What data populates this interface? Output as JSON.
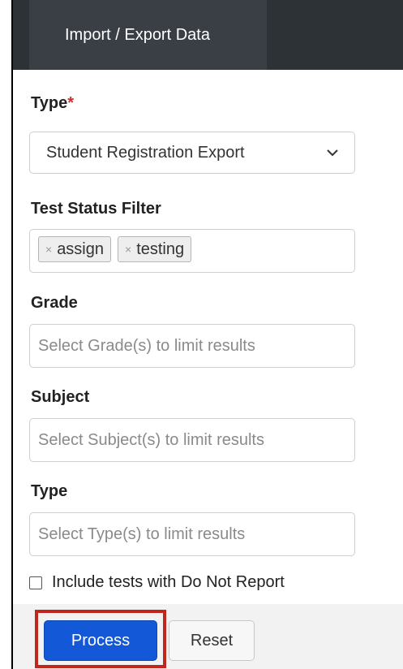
{
  "header": {
    "tab_title": "Import / Export Data"
  },
  "form": {
    "type_label": "Type",
    "required_marker": "*",
    "type_value": "Student Registration Export",
    "test_status_label": "Test Status Filter",
    "test_status_tags": [
      "assign",
      "testing"
    ],
    "tag_remove_glyph": "×",
    "grade_label": "Grade",
    "grade_placeholder": "Select Grade(s) to limit results",
    "subject_label": "Subject",
    "subject_placeholder": "Select Subject(s) to limit results",
    "type2_label": "Type",
    "type2_placeholder": "Select Type(s) to limit results",
    "do_not_report_label": "Include tests with Do Not Report",
    "do_not_report_checked": false
  },
  "actions": {
    "process_label": "Process",
    "reset_label": "Reset",
    "highlight_color": "#c0261b",
    "process_color": "#1358d6"
  }
}
